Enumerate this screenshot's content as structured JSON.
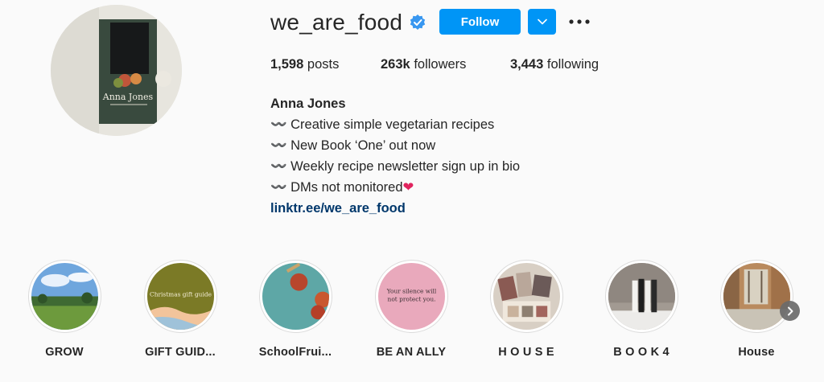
{
  "profile": {
    "username": "we_are_food",
    "follow_label": "Follow",
    "stats": {
      "posts_count": "1,598",
      "posts_label": "posts",
      "followers_count": "263k",
      "followers_label": "followers",
      "following_count": "3,443",
      "following_label": "following"
    },
    "bio": {
      "name": "Anna Jones",
      "lines": [
        "〰️ Creative simple vegetarian recipes",
        "〰️ New Book ‘One’ out now",
        "〰️ Weekly recipe newsletter sign up in bio",
        "〰️ DMs not monitored"
      ],
      "link": "linktr.ee/we_are_food"
    },
    "avatar_book_title": "Anna Jones"
  },
  "highlights": [
    {
      "label": "GROW"
    },
    {
      "label": "GIFT GUID..."
    },
    {
      "label": "SchoolFrui..."
    },
    {
      "label": "BE AN ALLY"
    },
    {
      "label": "H O U S E"
    },
    {
      "label": "B O O K 4"
    },
    {
      "label": "House"
    }
  ],
  "highlight_texts": {
    "gift_cover": "Christmas gift guide",
    "ally_cover_line1": "Your silence will",
    "ally_cover_line2": "not protect you."
  },
  "icons": {
    "verified": "verified-badge-icon",
    "dropdown": "chevron-down-icon",
    "more": "more-options-icon",
    "next": "chevron-right-icon",
    "heart": "red-heart-icon"
  },
  "colors": {
    "accent": "#0095f6",
    "link": "#00376b",
    "background": "#fafafa"
  }
}
